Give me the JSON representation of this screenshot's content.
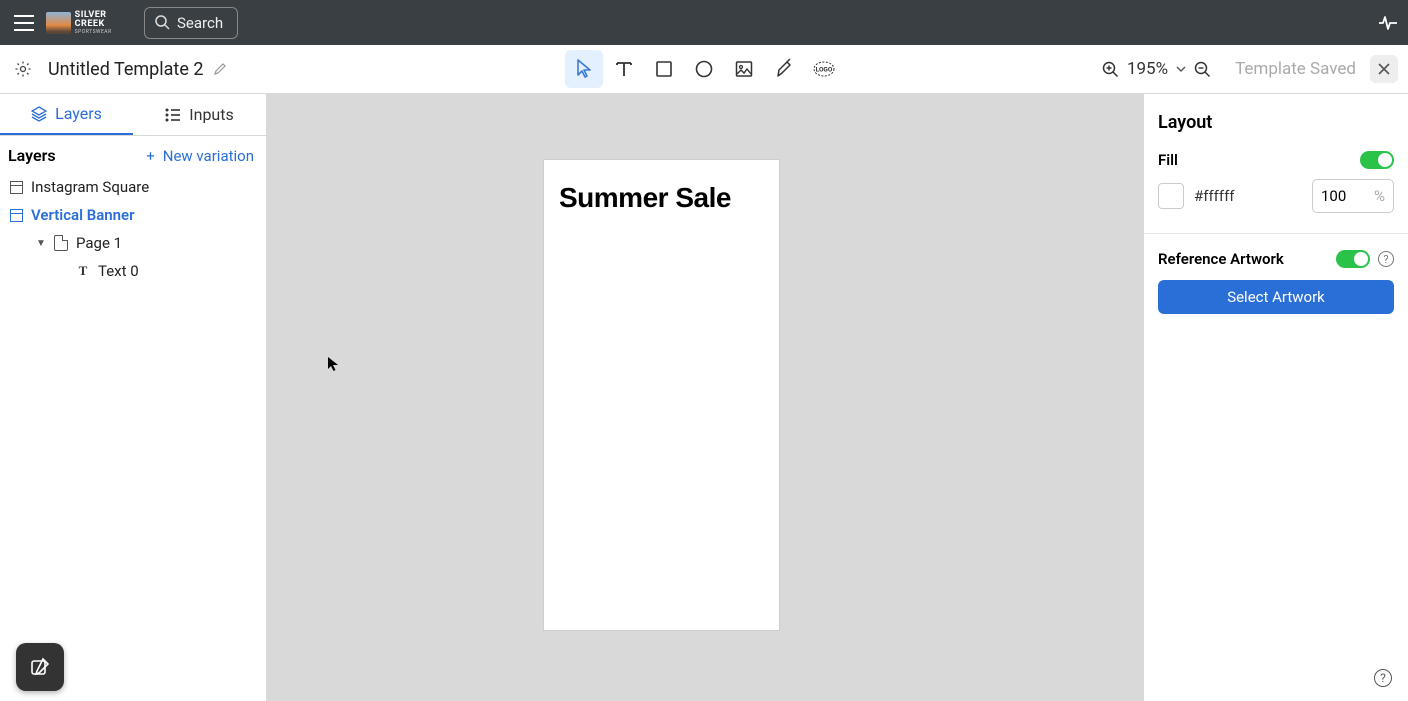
{
  "header": {
    "brand_name": "SILVER CREEK",
    "brand_sub": "SPORTSWEAR",
    "search_label": "Search"
  },
  "subheader": {
    "template_title": "Untitled Template 2",
    "zoom": "195%",
    "save_status": "Template Saved"
  },
  "left_panel": {
    "tabs": {
      "layers": "Layers",
      "inputs": "Inputs"
    },
    "section_title": "Layers",
    "new_variation": "New variation",
    "tree": {
      "instagram_square": "Instagram Square",
      "vertical_banner": "Vertical Banner",
      "page1": "Page 1",
      "text0": "Text 0"
    }
  },
  "canvas": {
    "artboard_text": "Summer Sale"
  },
  "right_panel": {
    "title": "Layout",
    "fill_label": "Fill",
    "fill_hex": "#ffffff",
    "fill_opacity": "100",
    "fill_opacity_unit": "%",
    "ref_artwork_label": "Reference Artwork",
    "select_artwork_btn": "Select Artwork"
  }
}
